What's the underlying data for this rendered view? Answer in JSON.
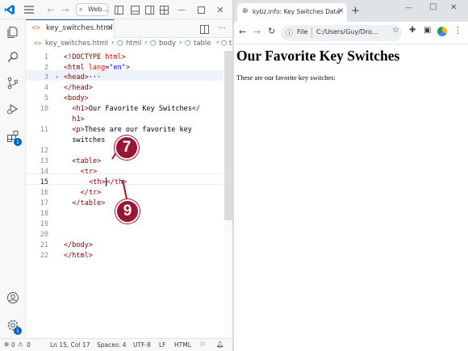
{
  "vscode": {
    "title_search": "Web...",
    "tab": {
      "filename": "key_switches.html",
      "close": "×"
    },
    "breadcrumb": [
      "key_switches.html",
      "html",
      "body",
      "table",
      "tr"
    ],
    "lines": [
      {
        "n": "1"
      },
      {
        "n": "2"
      },
      {
        "n": "3"
      },
      {
        "n": "4"
      },
      {
        "n": "5"
      },
      {
        "n": "10"
      },
      {
        "n": ""
      },
      {
        "n": "11"
      },
      {
        "n": ""
      },
      {
        "n": "12"
      },
      {
        "n": "13"
      },
      {
        "n": "14"
      },
      {
        "n": "15"
      },
      {
        "n": "16"
      },
      {
        "n": "17"
      },
      {
        "n": "18"
      },
      {
        "n": "19"
      },
      {
        "n": "20"
      },
      {
        "n": "21"
      },
      {
        "n": "22"
      }
    ],
    "code": {
      "l1a": "<!DOCTYPE ",
      "l1b": "html",
      "l1c": ">",
      "l2a": "<html ",
      "l2b": "lang",
      "l2c": "=",
      "l2d": "\"en\"",
      "l2e": ">",
      "l3a": "<head>",
      "l3b": "···",
      "l4": "</head>",
      "l5": "<body>",
      "l10a": "<h1>",
      "l10b": "Our Favorite Key Switches",
      "l10c": "</",
      "l10d": "h1>",
      "l11a": "<p>",
      "l11b": "These are our favorite key",
      "l11c": "switches",
      "l13": "<table>",
      "l14": "<tr>",
      "l15a": "<th>",
      "l15b": "</th>",
      "l16": "</tr>",
      "l17": "</table>",
      "l21": "</body>",
      "l22": "</html>"
    },
    "status": {
      "errors": "0",
      "warnings": "0",
      "position": "Ln 15, Col 17",
      "spaces": "Spaces: 4",
      "encoding": "UTF-8",
      "eol": "LF",
      "language": "HTML"
    },
    "badges": {
      "extensions": "1",
      "settings": "1"
    },
    "callouts": {
      "a": "7",
      "b": "9"
    }
  },
  "browser": {
    "tab_title": "kybz.info: Key Switches Data",
    "tab_close": "×",
    "new_tab": "+",
    "address_label": "File",
    "address": "C:/Users/Guy/Dro...",
    "page_heading": "Our Favorite Key Switches",
    "page_text": "These are our favorite key switches:"
  }
}
